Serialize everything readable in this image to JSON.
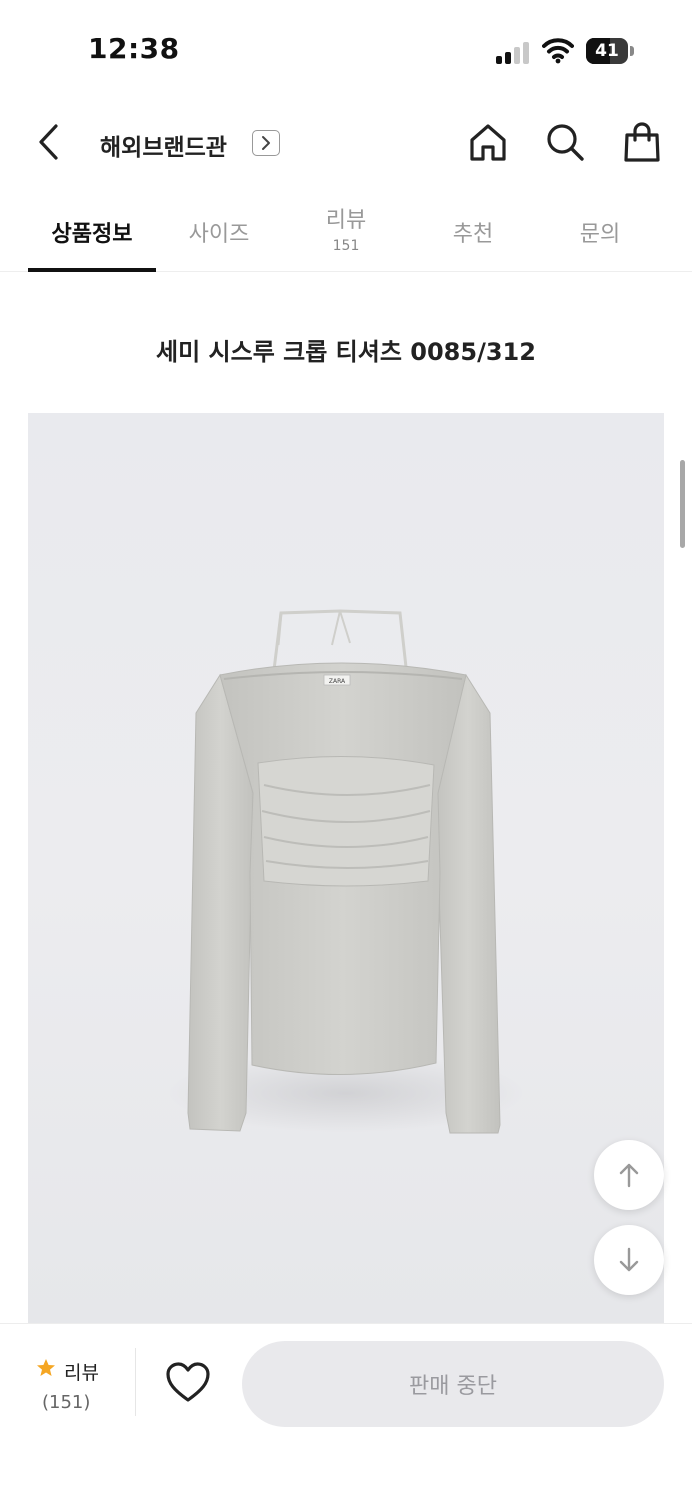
{
  "status_bar": {
    "time": "12:38",
    "battery_level": "41",
    "signal_bars_active": 2,
    "signal_bars_total": 4
  },
  "nav": {
    "brand_title": "해외브랜드관",
    "icons": [
      "chevron-left-icon",
      "chevron-right-icon",
      "home-icon",
      "search-icon",
      "shopping-bag-icon"
    ]
  },
  "tabs": [
    {
      "label": "상품정보",
      "active": true
    },
    {
      "label": "사이즈",
      "active": false
    },
    {
      "label": "리뷰",
      "count": "151",
      "active": false
    },
    {
      "label": "추천",
      "active": false
    },
    {
      "label": "문의",
      "active": false
    }
  ],
  "product": {
    "title": "세미 시스루 크롭 티셔츠 0085/312",
    "tag_text": "ZARA"
  },
  "fabs": {
    "icons": [
      "arrow-up-icon",
      "arrow-down-icon"
    ]
  },
  "bottom_bar": {
    "review_label": "리뷰",
    "review_count": "(151)",
    "buy_button_label": "판매 중단",
    "star_color": "#f5a623"
  }
}
